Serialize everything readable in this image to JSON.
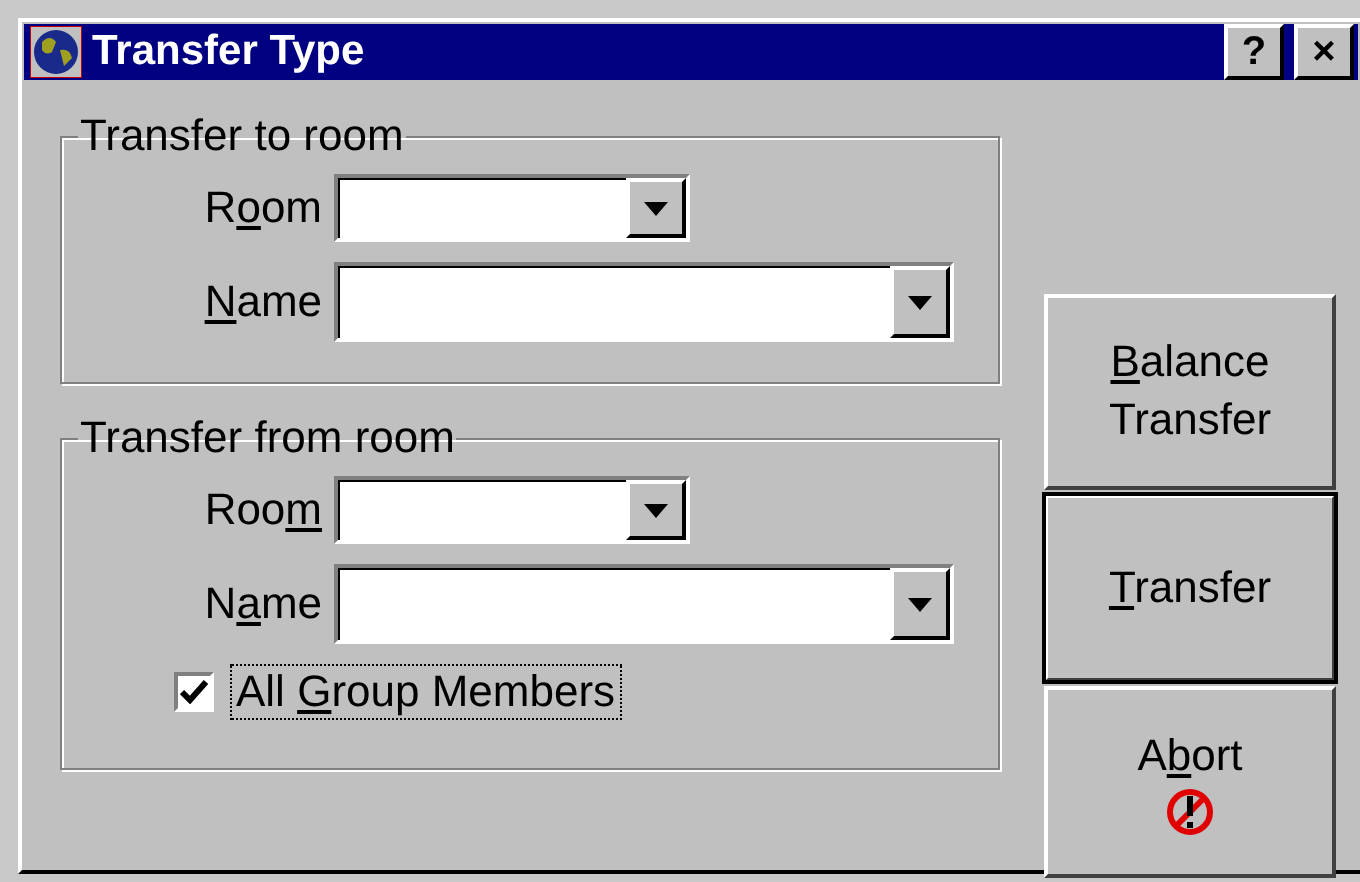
{
  "window": {
    "title": "Transfer Type",
    "help_button": "?",
    "close_button": "×"
  },
  "groups": [
    {
      "title": "Transfer to room",
      "fields": [
        {
          "kind": "short",
          "label": {
            "before": "R",
            "key": "o",
            "after": "om"
          }
        },
        {
          "kind": "long",
          "label": {
            "key": "N",
            "after": "ame"
          }
        }
      ]
    },
    {
      "title": "Transfer from room",
      "fields": [
        {
          "kind": "short",
          "label": {
            "before": "Roo",
            "key": "m"
          }
        },
        {
          "kind": "long",
          "label": {
            "before": "N",
            "key": "a",
            "after": "me"
          }
        }
      ],
      "checkbox": {
        "label": {
          "before": "All ",
          "key": "G",
          "after": "roup Members"
        },
        "checked": true,
        "focused": true
      }
    }
  ],
  "buttons": [
    {
      "kind": "plain",
      "label": {
        "key": "B",
        "after": "alance Transfer"
      },
      "default": false
    },
    {
      "kind": "plain",
      "label": {
        "key": "T",
        "after": "ransfer"
      },
      "default": true
    },
    {
      "kind": "abort",
      "label": {
        "before": "A",
        "key": "b",
        "after": "ort"
      },
      "default": false
    }
  ]
}
